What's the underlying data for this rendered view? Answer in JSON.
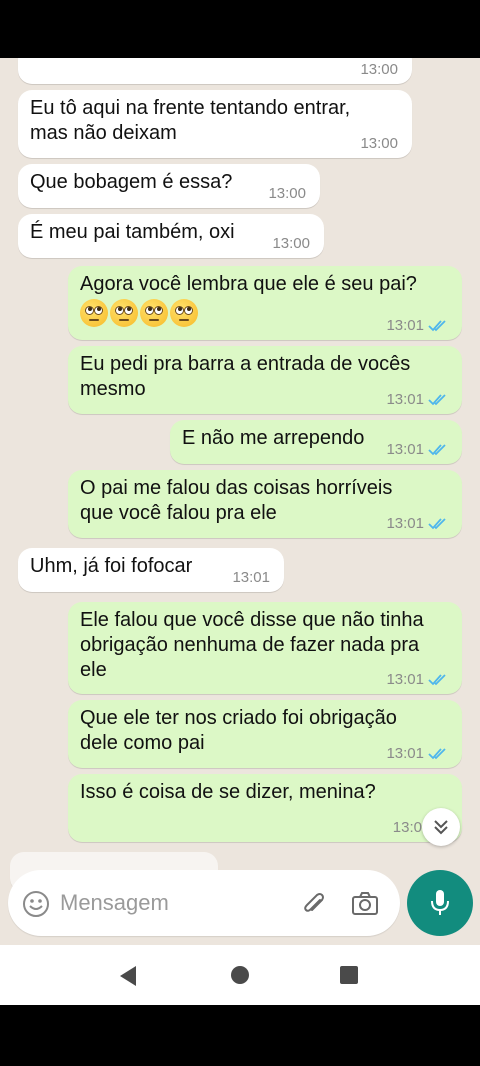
{
  "messages": [
    {
      "dir": "in",
      "text": "",
      "time": "13:00"
    },
    {
      "dir": "in",
      "text": "Eu tô aqui na frente tentando entrar,\nmas não deixam",
      "time": "13:00"
    },
    {
      "dir": "in",
      "text": "Que bobagem é essa?",
      "time": "13:00"
    },
    {
      "dir": "in",
      "text": "É meu pai também, oxi",
      "time": "13:00"
    },
    {
      "dir": "out",
      "text": "Agora você lembra que ele é seu pai?",
      "emoji": "🙄🙄🙄🙄",
      "emoji_names": [
        "eye-roll",
        "eye-roll",
        "eye-roll",
        "eye-roll"
      ],
      "time": "13:01",
      "status": "read"
    },
    {
      "dir": "out",
      "text": "Eu pedi pra barra a entrada de vocês\nmesmo",
      "time": "13:01",
      "status": "read"
    },
    {
      "dir": "out",
      "text": "E não me arrependo",
      "time": "13:01",
      "status": "read"
    },
    {
      "dir": "out",
      "text": "O pai me falou das coisas horríveis\nque você falou pra ele",
      "time": "13:01",
      "status": "read"
    },
    {
      "dir": "in",
      "text": "Uhm, já foi fofocar",
      "time": "13:01"
    },
    {
      "dir": "out",
      "text": "Ele falou que você disse que não tinha\nobrigação nenhuma de fazer nada pra\nele",
      "time": "13:01",
      "status": "read"
    },
    {
      "dir": "out",
      "text": "Que ele ter nos criado foi obrigação\ndele como pai",
      "time": "13:01",
      "status": "read"
    },
    {
      "dir": "out",
      "text": "Isso é coisa de se dizer, menina?",
      "time": "13:0",
      "status": "read"
    }
  ],
  "input": {
    "placeholder": "Mensagem"
  },
  "icons": {
    "emoji": "emoji-icon",
    "attach": "paperclip-icon",
    "camera": "camera-icon",
    "mic": "mic-icon",
    "scroll": "chevron-double-down-icon",
    "back": "back-triangle-icon",
    "home": "home-circle-icon",
    "recents": "recents-square-icon"
  },
  "colors": {
    "incoming": "#ffffff",
    "outgoing": "#dcf8c6",
    "accent": "#128c7e",
    "tick": "#4fb6ec",
    "chat_bg": "#ece5dd"
  }
}
